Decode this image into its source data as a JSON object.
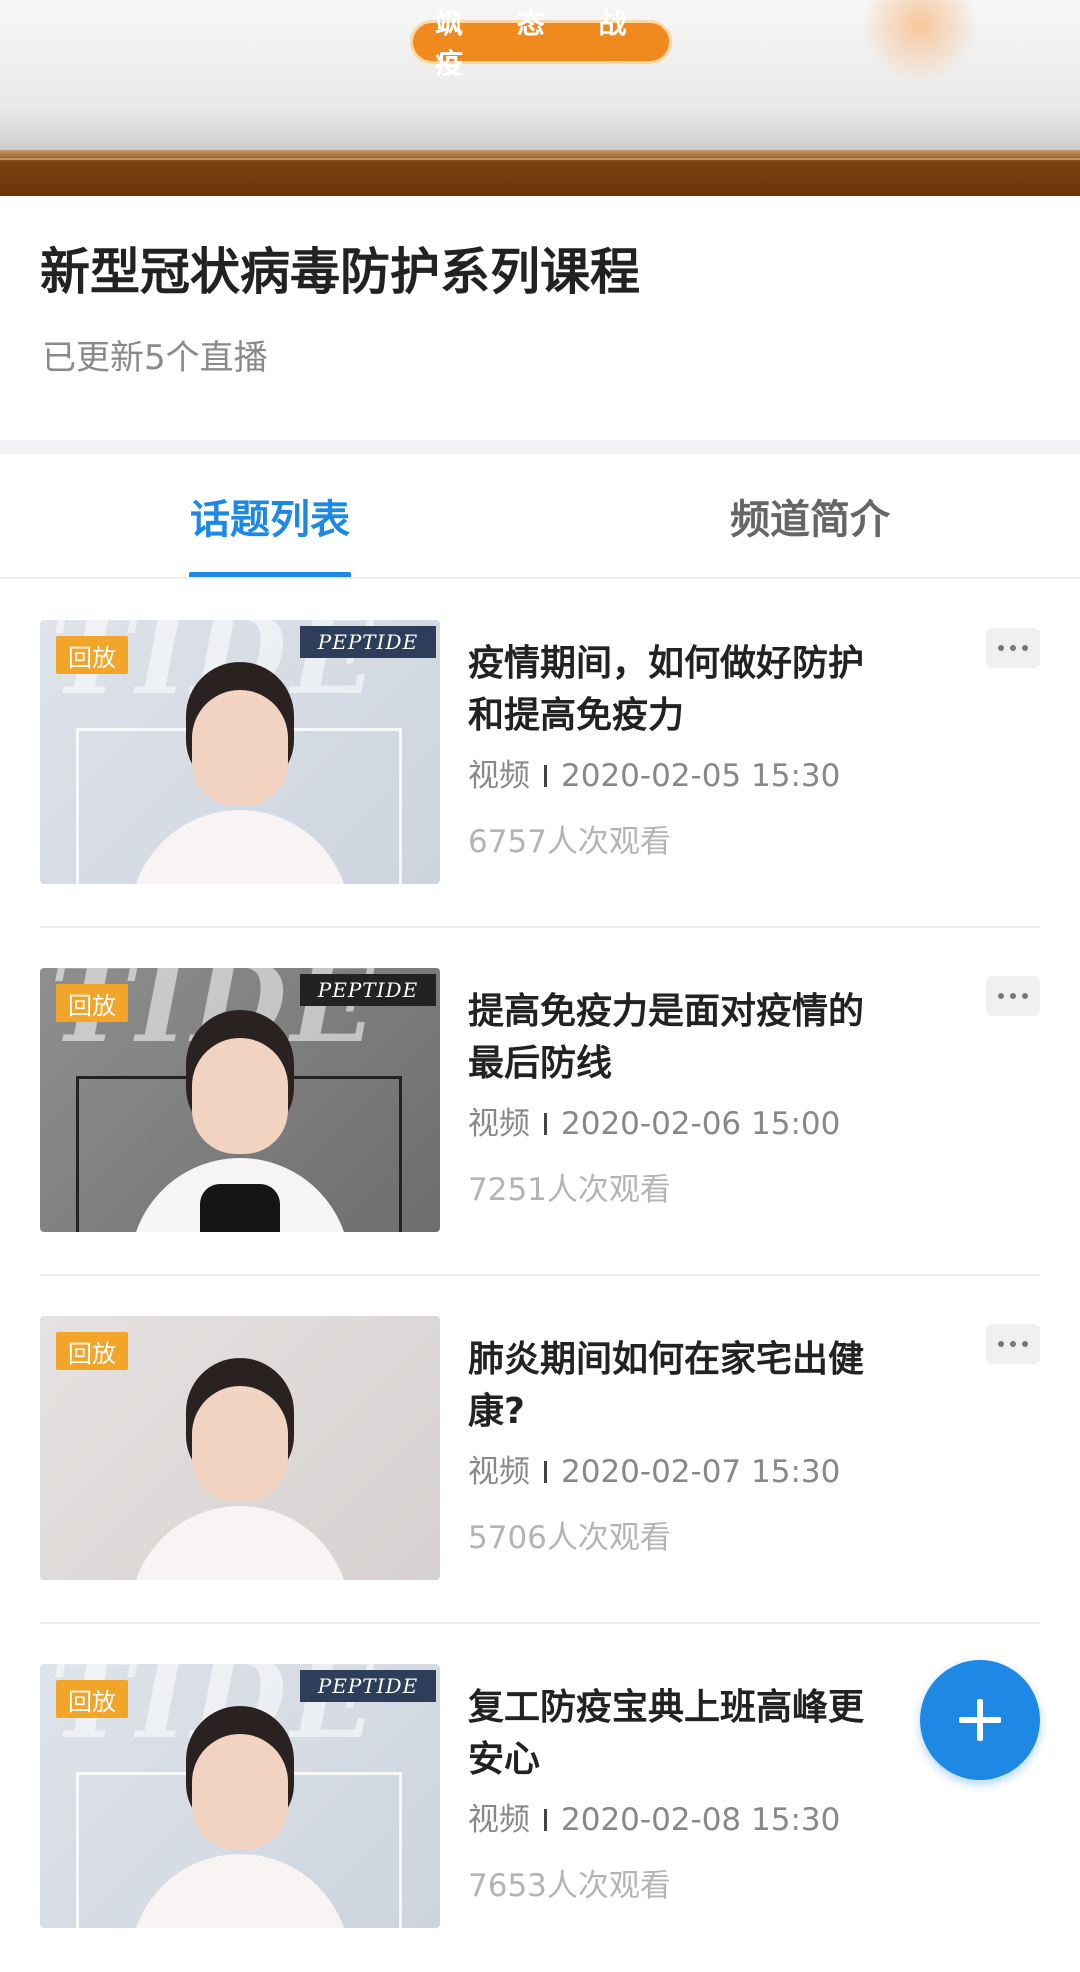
{
  "banner": {
    "slogan": "飒 态 战 疫"
  },
  "header": {
    "title": "新型冠状病毒防护系列课程",
    "subtitle": "已更新5个直播"
  },
  "tabs": [
    {
      "label": "话题列表",
      "active": true
    },
    {
      "label": "频道简介",
      "active": false
    }
  ],
  "items": [
    {
      "badge": "回放",
      "title": "疫情期间，如何做好防护和提高免疫力",
      "type": "视频",
      "datetime": "2020-02-05 15:30",
      "views": "6757人次观看",
      "thumb_text": "PEPTIDE"
    },
    {
      "badge": "回放",
      "title": "提高免疫力是面对疫情的最后防线",
      "type": "视频",
      "datetime": "2020-02-06 15:00",
      "views": "7251人次观看",
      "thumb_text": "PEPTIDE"
    },
    {
      "badge": "回放",
      "title": "肺炎期间如何在家宅出健康?",
      "type": "视频",
      "datetime": "2020-02-07 15:30",
      "views": "5706人次观看"
    },
    {
      "badge": "回放",
      "title": "复工防疫宝典上班高峰更安心",
      "type": "视频",
      "datetime": "2020-02-08 15:30",
      "views": "7653人次观看",
      "thumb_text": "PEPTIDE"
    }
  ],
  "icons": {
    "more": "more-horizontal-icon",
    "fab": "plus-icon"
  },
  "colors": {
    "accent": "#1e88e5",
    "badge": "#f3a52a",
    "slogan_pill": "#f08a1e"
  }
}
